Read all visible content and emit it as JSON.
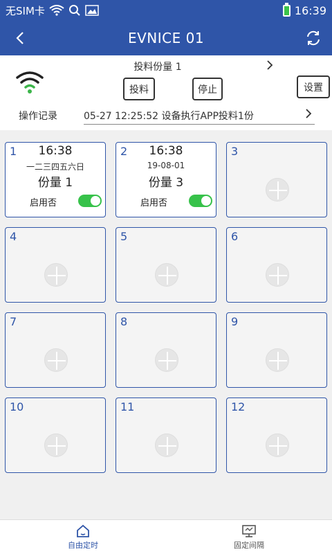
{
  "status_bar": {
    "carrier": "无SIM卡",
    "time": "16:39"
  },
  "header": {
    "title": "EVNICE 01"
  },
  "control": {
    "feed_title": "投料份量 1",
    "feed_button": "投料",
    "stop_button": "停止",
    "settings_button": "设置",
    "log_label": "操作记录",
    "log_text": "05-27 12:25:52 设备执行APP投料1份"
  },
  "schedules": [
    {
      "number": "1",
      "time": "16:38",
      "days": "一二三四五六日",
      "amount": "份量 1",
      "enable_label": "启用否",
      "enabled": true
    },
    {
      "number": "2",
      "time": "16:38",
      "days": "19-08-01",
      "amount": "份量 3",
      "enable_label": "启用否",
      "enabled": true
    },
    {
      "number": "3"
    },
    {
      "number": "4"
    },
    {
      "number": "5"
    },
    {
      "number": "6"
    },
    {
      "number": "7"
    },
    {
      "number": "8"
    },
    {
      "number": "9"
    },
    {
      "number": "10"
    },
    {
      "number": "11"
    },
    {
      "number": "12"
    }
  ],
  "nav": [
    {
      "label": "自由定时",
      "icon": "home-icon",
      "active": true
    },
    {
      "label": "固定间隔",
      "icon": "monitor-icon",
      "active": false
    }
  ],
  "colors": {
    "primary": "#2f55a8",
    "toggle_on": "#37c24a",
    "wifi_green": "#3cb54a"
  }
}
